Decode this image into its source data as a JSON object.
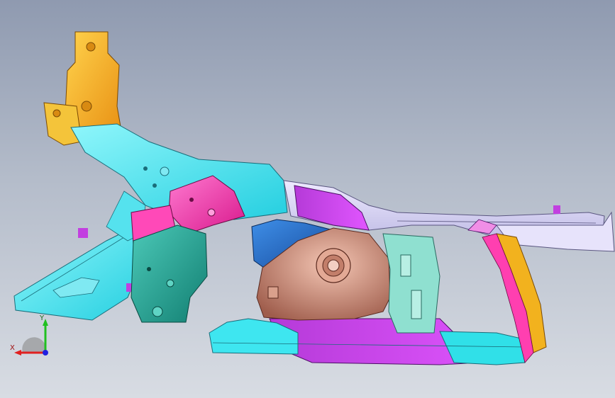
{
  "viewport": {
    "background_top": "#8f9ab0",
    "background_bottom": "#d8dce3"
  },
  "model": {
    "parts": [
      {
        "name": "shock-tower-bracket",
        "color": "#f5a623"
      },
      {
        "name": "front-rail-upper",
        "color": "#3ee6f0"
      },
      {
        "name": "front-rail-lower",
        "color": "#2fd8e6"
      },
      {
        "name": "apron-reinforcement",
        "color": "#ff3fb0"
      },
      {
        "name": "cowl-side-panel",
        "color": "#1ea89a"
      },
      {
        "name": "wheelhouse-inner",
        "color": "#c98a78"
      },
      {
        "name": "wheelhouse-brace",
        "color": "#1f6fc8"
      },
      {
        "name": "sill-outer",
        "color": "#c23fe0"
      },
      {
        "name": "rocker-panel",
        "color": "#30e0e8"
      },
      {
        "name": "a-pillar-inner",
        "color": "#f2b21e"
      },
      {
        "name": "roof-rail",
        "color": "#d8d4f2"
      },
      {
        "name": "hinge-pillar",
        "color": "#8fe0d0"
      }
    ]
  },
  "triad": {
    "x_label": "X",
    "y_label": "Y",
    "x_color": "#e02020",
    "y_color": "#20c020",
    "z_color": "#2020e0"
  }
}
